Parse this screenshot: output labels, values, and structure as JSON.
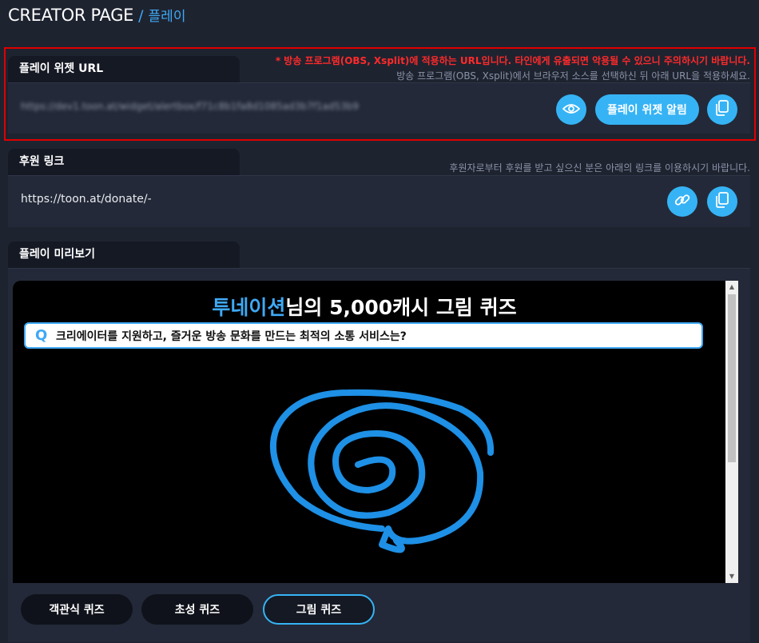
{
  "header": {
    "title": "CREATOR PAGE",
    "separator": "/",
    "subtitle": "플레이"
  },
  "widget": {
    "tab_label": "플레이 위젯 URL",
    "warning": "* 방송 프로그램(OBS, Xsplit)에 적용하는 URL입니다. 타인에게 유출되면 악용될 수 있으니 주의하시기 바랍니다.",
    "hint": "방송 프로그램(OBS, Xsplit)에서 브라우저 소스를 선택하신 뒤 아래 URL을 적용하세요.",
    "url": "https://dev1.toon.at/widget/alertbox/f71c8b1fa8d1085ad3b7f1ad53b9",
    "alert_button": "플레이 위젯 알림"
  },
  "donate": {
    "tab_label": "후원 링크",
    "hint": "후원자로부터 후원를 받고 싶으신 분은 아래의 링크를 이용하시기 바랍니다.",
    "url": "https://toon.at/donate/-"
  },
  "preview": {
    "tab_label": "플레이 미리보기",
    "title_name": "투네이션",
    "title_rest": "님의 5,000캐시 그림 퀴즈",
    "q_mark": "Q",
    "question": "크리에이터를 지원하고, 즐거운 방송 문화를 만드는 최적의 소통 서비스는?",
    "drawing_color": "#1e90e6",
    "scroll_up": "▲",
    "scroll_down": "▼"
  },
  "quiz_buttons": [
    {
      "label": "객관식 퀴즈",
      "active": false
    },
    {
      "label": "초성 퀴즈",
      "active": false
    },
    {
      "label": "그림 퀴즈",
      "active": true
    }
  ],
  "icons": [
    "eye-icon",
    "copy-icon",
    "link-icon",
    "copy-icon"
  ],
  "colors": {
    "accent": "#36b3f5",
    "warning": "#ff2a2a",
    "background": "#1e2330"
  }
}
